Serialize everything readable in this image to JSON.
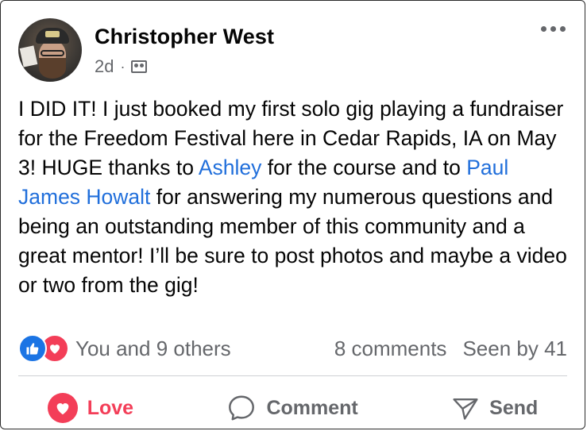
{
  "post": {
    "author": "Christopher West",
    "time": "2d",
    "separator": "·",
    "audience_icon": "group-icon",
    "more_icon": "more-options-icon",
    "text": {
      "p1": "I DID IT! I just booked my first solo gig playing a fundraiser for the Freedom Festival here in Cedar Rapids, IA on May 3! HUGE thanks to ",
      "mention1": "Ashley",
      "p2": " for the course and to ",
      "mention2": "Paul James Howalt",
      "p3": " for answering my numerous questions and being an outstanding member of this community and a great mentor! I’ll be sure to post photos and maybe a video or two from the gig!"
    },
    "mention_color": "#216fdb"
  },
  "reactions": {
    "icons": [
      "like-icon",
      "love-icon"
    ],
    "summary": "You and 9 others",
    "comments": "8 comments",
    "seen": "Seen by 41"
  },
  "actions": {
    "love": "Love",
    "comment": "Comment",
    "send": "Send"
  },
  "colors": {
    "love": "#f33e58",
    "like": "#1b74e4",
    "muted": "#65676b"
  }
}
